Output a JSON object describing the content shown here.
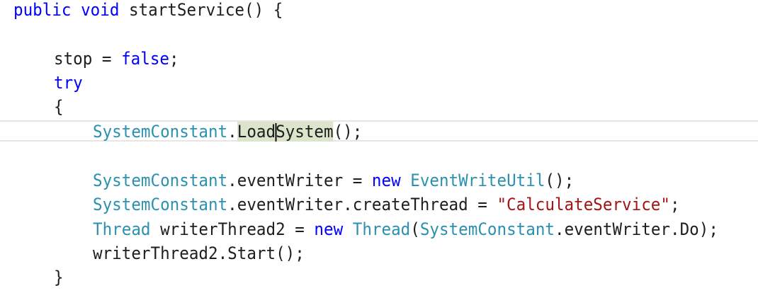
{
  "code": {
    "l1": {
      "kw1": "public",
      "kw2": "void",
      "name": "startService",
      "paren": "()",
      "brace": "{"
    },
    "l2": {
      "lhs": "stop",
      "eq": "=",
      "val": "false",
      "semi": ";"
    },
    "l3": {
      "kw": "try"
    },
    "l4": {
      "brace": "{"
    },
    "l5": {
      "cls": "SystemConstant",
      "dot": ".",
      "m1": "Load",
      "m2": "System",
      "tail": "();"
    },
    "l6": {
      "cls": "SystemConstant",
      "mid": ".eventWriter =",
      "kw": "new",
      "type": "EventWriteUtil",
      "tail": "();"
    },
    "l7": {
      "cls": "SystemConstant",
      "mid": ".eventWriter.createThread =",
      "str": "\"CalculateService\"",
      "tail": ";"
    },
    "l8": {
      "type1": "Thread",
      "mid": "writerThread2 =",
      "kw": "new",
      "type2": "Thread",
      "open": "(",
      "cls": "SystemConstant",
      "tail": ".eventWriter.Do);"
    },
    "l9": {
      "text": "writerThread2.Start();"
    },
    "l10": {
      "brace": "}"
    }
  }
}
